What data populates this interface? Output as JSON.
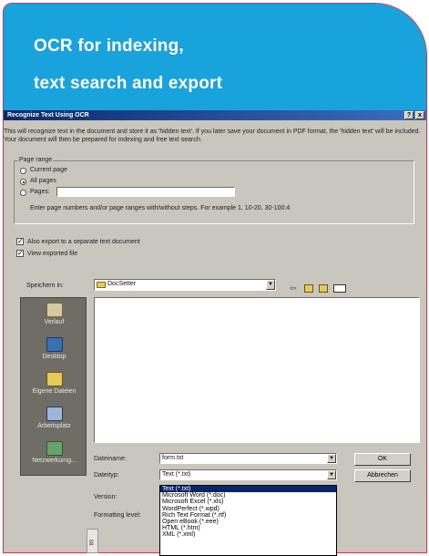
{
  "hero": {
    "line1": "OCR for indexing,",
    "line2": "text search and export"
  },
  "dialog": {
    "title": "Recognize Text Using OCR",
    "help_label": "?",
    "close_label": "x",
    "description": "This will recognize text in the document and store it as 'hidden text'. If you later save your document in PDF format, the 'hidden text' will be included. Your document will then be prepared for indexing and free text search.",
    "page_range": {
      "label": "Page range",
      "current": "Current page",
      "all": "All pages",
      "pages": "Pages:",
      "pages_value": "",
      "hint": "Enter page numbers and/or page ranges with/without steps. For example 1, 10-20, 30-100:4"
    },
    "also_export": "Also export to a separate text document",
    "view_exported": "View exported file",
    "save_in_label": "Speichern in:",
    "save_in_value": "DocSetter",
    "places": [
      {
        "label": "Verlauf",
        "icon": "history-icon"
      },
      {
        "label": "Desktop",
        "icon": "desktop-icon"
      },
      {
        "label": "Eigene Dateien",
        "icon": "my-documents-icon"
      },
      {
        "label": "Arbeitsplatz",
        "icon": "my-computer-icon"
      },
      {
        "label": "Netzwerkumg...",
        "icon": "network-icon"
      }
    ],
    "filename_label": "Dateiname:",
    "filename_value": "form.txt",
    "filetype_label": "Dateityp:",
    "filetype_value": "Text (*.txt)",
    "version_label": "Version:",
    "formatting_label": "Formatting level:",
    "ok_label": "OK",
    "cancel_label": "Abbrechen",
    "filetype_options": [
      "Text (*.txt)",
      "Microsoft Word (*.doc)",
      "Microsoft Excel (*.xls)",
      "WordPerfect (*.wpd)",
      "Rich Text Format (*.rtf)",
      "Open eBook (*.eee)",
      "HTML (*.htm)",
      "XML (*.xml)"
    ],
    "bottom_tab": "80"
  },
  "colors": {
    "hero_blue": "#19a3dd",
    "border_red": "#d9314f",
    "title_bar": "#0a2a6e",
    "dialog_bg": "#c9c6bd"
  }
}
